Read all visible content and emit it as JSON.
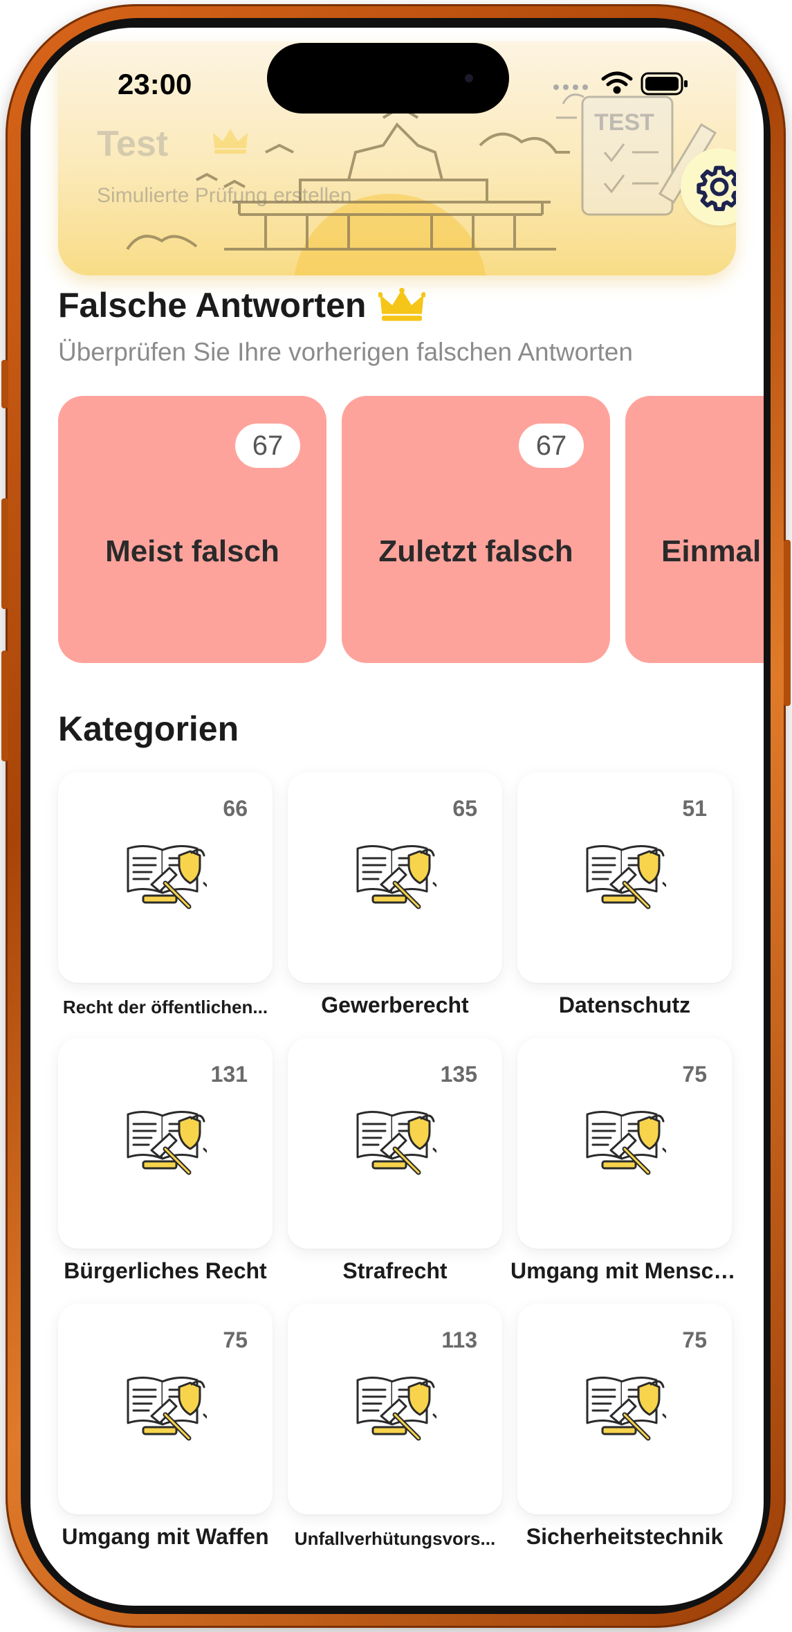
{
  "status_bar": {
    "time": "23:00"
  },
  "banner": {
    "title": "Test",
    "subtitle": "Simulierte Prüfung erstellen",
    "art_label": "TEST"
  },
  "wrong_answers": {
    "title": "Falsche Antworten",
    "subtitle": "Überprüfen Sie Ihre vorherigen falschen Antworten",
    "cards": [
      {
        "label": "Meist falsch",
        "count": "67"
      },
      {
        "label": "Zuletzt falsch",
        "count": "67"
      },
      {
        "label": "Einmal"
      }
    ]
  },
  "categories": {
    "title": "Kategorien",
    "items": [
      {
        "label": "Recht der öffentlichen...",
        "count": "66"
      },
      {
        "label": "Gewerberecht",
        "count": "65"
      },
      {
        "label": "Datenschutz",
        "count": "51"
      },
      {
        "label": "Bürgerliches Recht",
        "count": "131"
      },
      {
        "label": "Strafrecht",
        "count": "135"
      },
      {
        "label": "Umgang mit Menschen",
        "count": "75"
      },
      {
        "label": "Umgang mit Waffen",
        "count": "75"
      },
      {
        "label": "Unfallverhütungsvors...",
        "count": "113"
      },
      {
        "label": "Sicherheitstechnik",
        "count": "75"
      }
    ]
  },
  "colors": {
    "wrong_card": "#fea39c",
    "crown": "#f5c518",
    "settings_bg": "#fdf8c8",
    "settings_icon": "#1d2350",
    "frame": "#c1570f"
  },
  "icons": {
    "crown": "crown-icon",
    "settings": "gear-icon",
    "category": "law-book-gavel-icon"
  }
}
